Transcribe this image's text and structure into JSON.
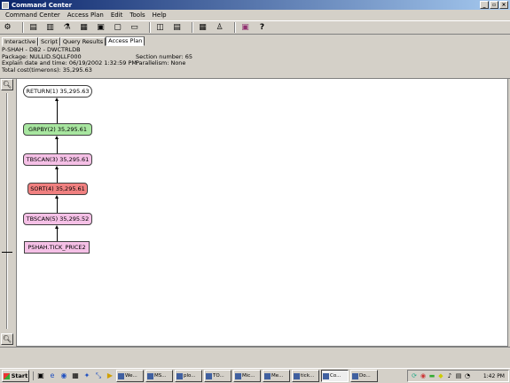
{
  "window": {
    "title": "Command Center",
    "controls": [
      "_",
      "▫",
      "×"
    ]
  },
  "menu": [
    "Command Center",
    "Access Plan",
    "Edit",
    "Tools",
    "Help"
  ],
  "toolbar": [
    "command-center-icon",
    "script-center-icon",
    "journal-icon",
    "info-center-icon",
    "control-center-icon",
    "replication-icon",
    "task-icon",
    "license-icon",
    "visual-explain-icon",
    "tree-icon",
    "settings-icon",
    "help-icon"
  ],
  "tabs": [
    {
      "label": "Interactive",
      "active": false
    },
    {
      "label": "Script",
      "active": false
    },
    {
      "label": "Query Results",
      "active": false
    },
    {
      "label": "Access Plan",
      "active": true
    }
  ],
  "info": {
    "line1": "P-SHAH - DB2 - DWCTRLDB",
    "package": "Package: NULLID.SQLLF000",
    "section": "Section number: 65",
    "explain": "Explain date and time: 06/19/2002 1:32:59 PM",
    "parallelism": "Parallelism: None",
    "total_cost": "Total cost(timerons): 35,295.63"
  },
  "plan_nodes": [
    {
      "label": "RETURN(1) 35,295.63",
      "kind": "return"
    },
    {
      "label": "GRPBY(2) 35,295.61",
      "kind": "grpby"
    },
    {
      "label": "TBSCAN(3) 35,295.61",
      "kind": "tbscan"
    },
    {
      "label": "SORT(4) 35,295.61",
      "kind": "sort"
    },
    {
      "label": "TBSCAN(5) 35,295.52",
      "kind": "tbscan"
    },
    {
      "label": "PSHAH.TICK_PRICE2",
      "kind": "table"
    }
  ],
  "zoom": {
    "in": "+",
    "out": "−"
  },
  "taskbar": {
    "start": "Start",
    "tasks": [
      {
        "label": "We...",
        "active": false
      },
      {
        "label": "MS...",
        "active": false
      },
      {
        "label": "plo...",
        "active": false
      },
      {
        "label": "TO...",
        "active": false
      },
      {
        "label": "Mic...",
        "active": false
      },
      {
        "label": "Me...",
        "active": false
      },
      {
        "label": "tick...",
        "active": false
      },
      {
        "label": "Co...",
        "active": true
      },
      {
        "label": "Do...",
        "active": false
      }
    ],
    "clock": "1:42 PM"
  }
}
